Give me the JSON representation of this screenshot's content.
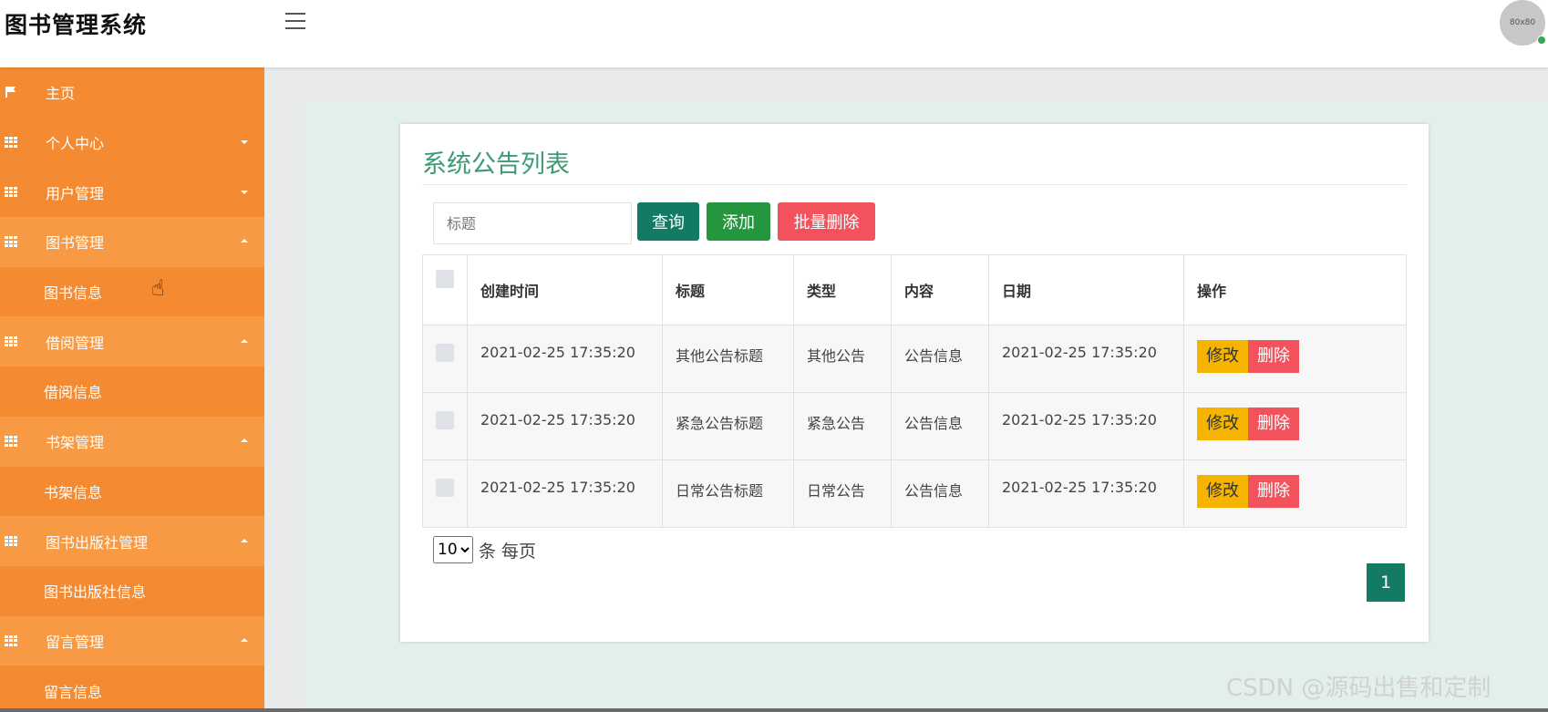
{
  "app": {
    "title": "图书管理系统",
    "avatar_text": "80x80"
  },
  "sidebar": {
    "items": [
      {
        "label": "主页",
        "type": "top",
        "icon": "flag-icon"
      },
      {
        "label": "个人中心",
        "type": "top",
        "icon": "grid-icon",
        "caret": "down"
      },
      {
        "label": "用户管理",
        "type": "top",
        "icon": "grid-icon",
        "caret": "down"
      },
      {
        "label": "图书管理",
        "type": "top-open",
        "icon": "grid-icon",
        "caret": "up"
      },
      {
        "label": "图书信息",
        "type": "child"
      },
      {
        "label": "借阅管理",
        "type": "top-open",
        "icon": "grid-icon",
        "caret": "up"
      },
      {
        "label": "借阅信息",
        "type": "child"
      },
      {
        "label": "书架管理",
        "type": "top-open",
        "icon": "grid-icon",
        "caret": "up"
      },
      {
        "label": "书架信息",
        "type": "child"
      },
      {
        "label": "图书出版社管理",
        "type": "top-open",
        "icon": "grid-icon",
        "caret": "up"
      },
      {
        "label": "图书出版社信息",
        "type": "child"
      },
      {
        "label": "留言管理",
        "type": "top-open",
        "icon": "grid-icon",
        "caret": "up"
      },
      {
        "label": "留言信息",
        "type": "child"
      }
    ]
  },
  "main": {
    "title": "系统公告列表",
    "search": {
      "placeholder": "标题",
      "value": ""
    },
    "buttons": {
      "query": "查询",
      "add": "添加",
      "batch_delete": "批量删除"
    },
    "table": {
      "headers": [
        "创建时间",
        "标题",
        "类型",
        "内容",
        "日期",
        "操作"
      ],
      "rows": [
        {
          "created": "2021-02-25 17:35:20",
          "title": "其他公告标题",
          "type": "其他公告",
          "content": "公告信息",
          "date": "2021-02-25 17:35:20"
        },
        {
          "created": "2021-02-25 17:35:20",
          "title": "紧急公告标题",
          "type": "紧急公告",
          "content": "公告信息",
          "date": "2021-02-25 17:35:20"
        },
        {
          "created": "2021-02-25 17:35:20",
          "title": "日常公告标题",
          "type": "日常公告",
          "content": "公告信息",
          "date": "2021-02-25 17:35:20"
        }
      ],
      "edit_label": "修改",
      "delete_label": "删除"
    },
    "pagination": {
      "page_size": "10",
      "page_size_label": "条 每页",
      "current_page": "1"
    }
  },
  "watermark": "CSDN @源码出售和定制",
  "colors": {
    "sidebar": "#f48b33",
    "accent": "#137a66",
    "add": "#26963e",
    "danger": "#f2525c",
    "warning": "#f4b400",
    "title": "#3d9b74"
  }
}
